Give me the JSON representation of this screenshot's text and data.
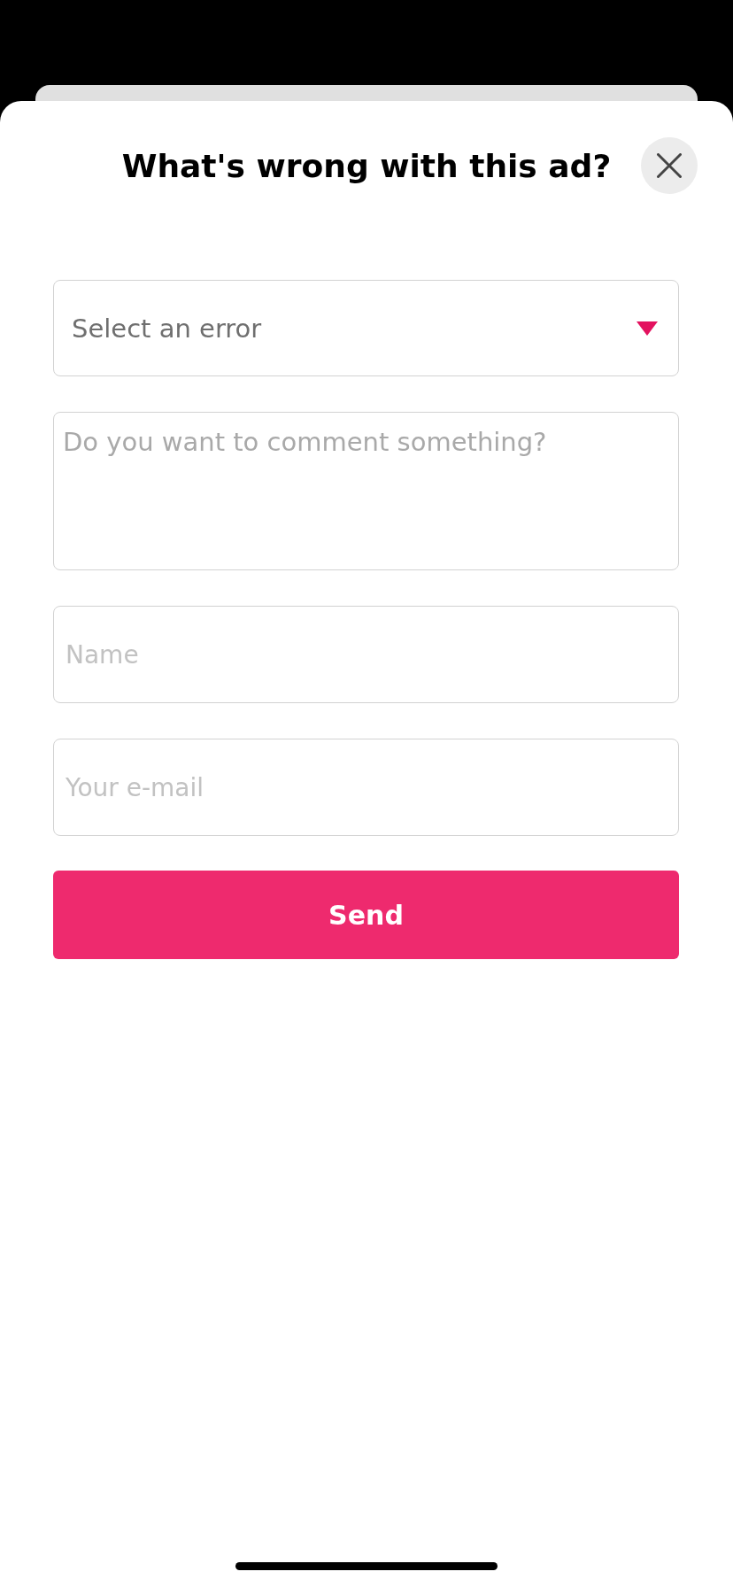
{
  "sheet": {
    "title": "What's wrong with this ad?"
  },
  "form": {
    "fields": [
      {
        "kind": "select",
        "placeholder": "Select an error"
      },
      {
        "kind": "textarea",
        "placeholder": "Do you want to comment something?"
      },
      {
        "kind": "text",
        "placeholder": "Name"
      },
      {
        "kind": "text",
        "placeholder": "Your e-mail"
      }
    ],
    "submit": "Send"
  }
}
